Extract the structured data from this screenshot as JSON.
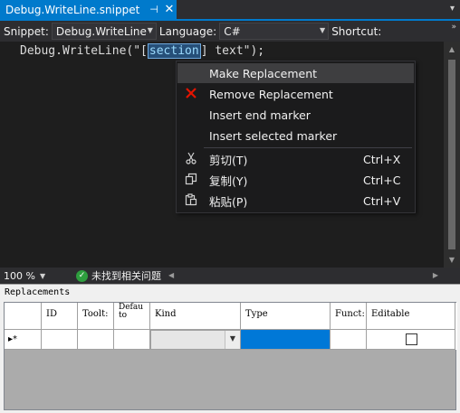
{
  "tab": {
    "title": "Debug.WriteLine.snippet",
    "pin_glyph": "⊣",
    "close_glyph": "✕",
    "dropdown_glyph": "▾"
  },
  "toolbar": {
    "snippet_label": "Snippet:",
    "snippet_value": "Debug.WriteLine",
    "language_label": "Language:",
    "language_value": "C#",
    "shortcut_label": "Shortcut:",
    "overflow_glyph": "»"
  },
  "editor": {
    "code_before": "Debug.WriteLine(\"[",
    "code_highlight": "section",
    "code_after": "] text\");"
  },
  "context_menu": {
    "items": [
      {
        "label": "Make Replacement",
        "shortcut": "",
        "icon": ""
      },
      {
        "label": "Remove Replacement",
        "shortcut": "",
        "icon": "remove-x-icon"
      },
      {
        "label": "Insert end marker",
        "shortcut": "",
        "icon": ""
      },
      {
        "label": "Insert selected marker",
        "shortcut": "",
        "icon": ""
      },
      {
        "label": "剪切(T)",
        "shortcut": "Ctrl+X",
        "icon": "scissors-icon"
      },
      {
        "label": "复制(Y)",
        "shortcut": "Ctrl+C",
        "icon": "copy-icon"
      },
      {
        "label": "粘贴(P)",
        "shortcut": "Ctrl+V",
        "icon": "paste-icon"
      }
    ]
  },
  "status": {
    "zoom": "100 %",
    "issues": "未找到相关问题"
  },
  "replacements": {
    "title": "Replacements",
    "columns": [
      "ID",
      "Toolt:",
      "Defau to",
      "Kind",
      "Type",
      "Funct:",
      "Editable"
    ],
    "new_row_indicator": "▸*"
  },
  "colors": {
    "accent": "#007acc",
    "selection": "#0078d7",
    "remove_icon": "#e51400",
    "ok_icon": "#2e9e3e"
  }
}
